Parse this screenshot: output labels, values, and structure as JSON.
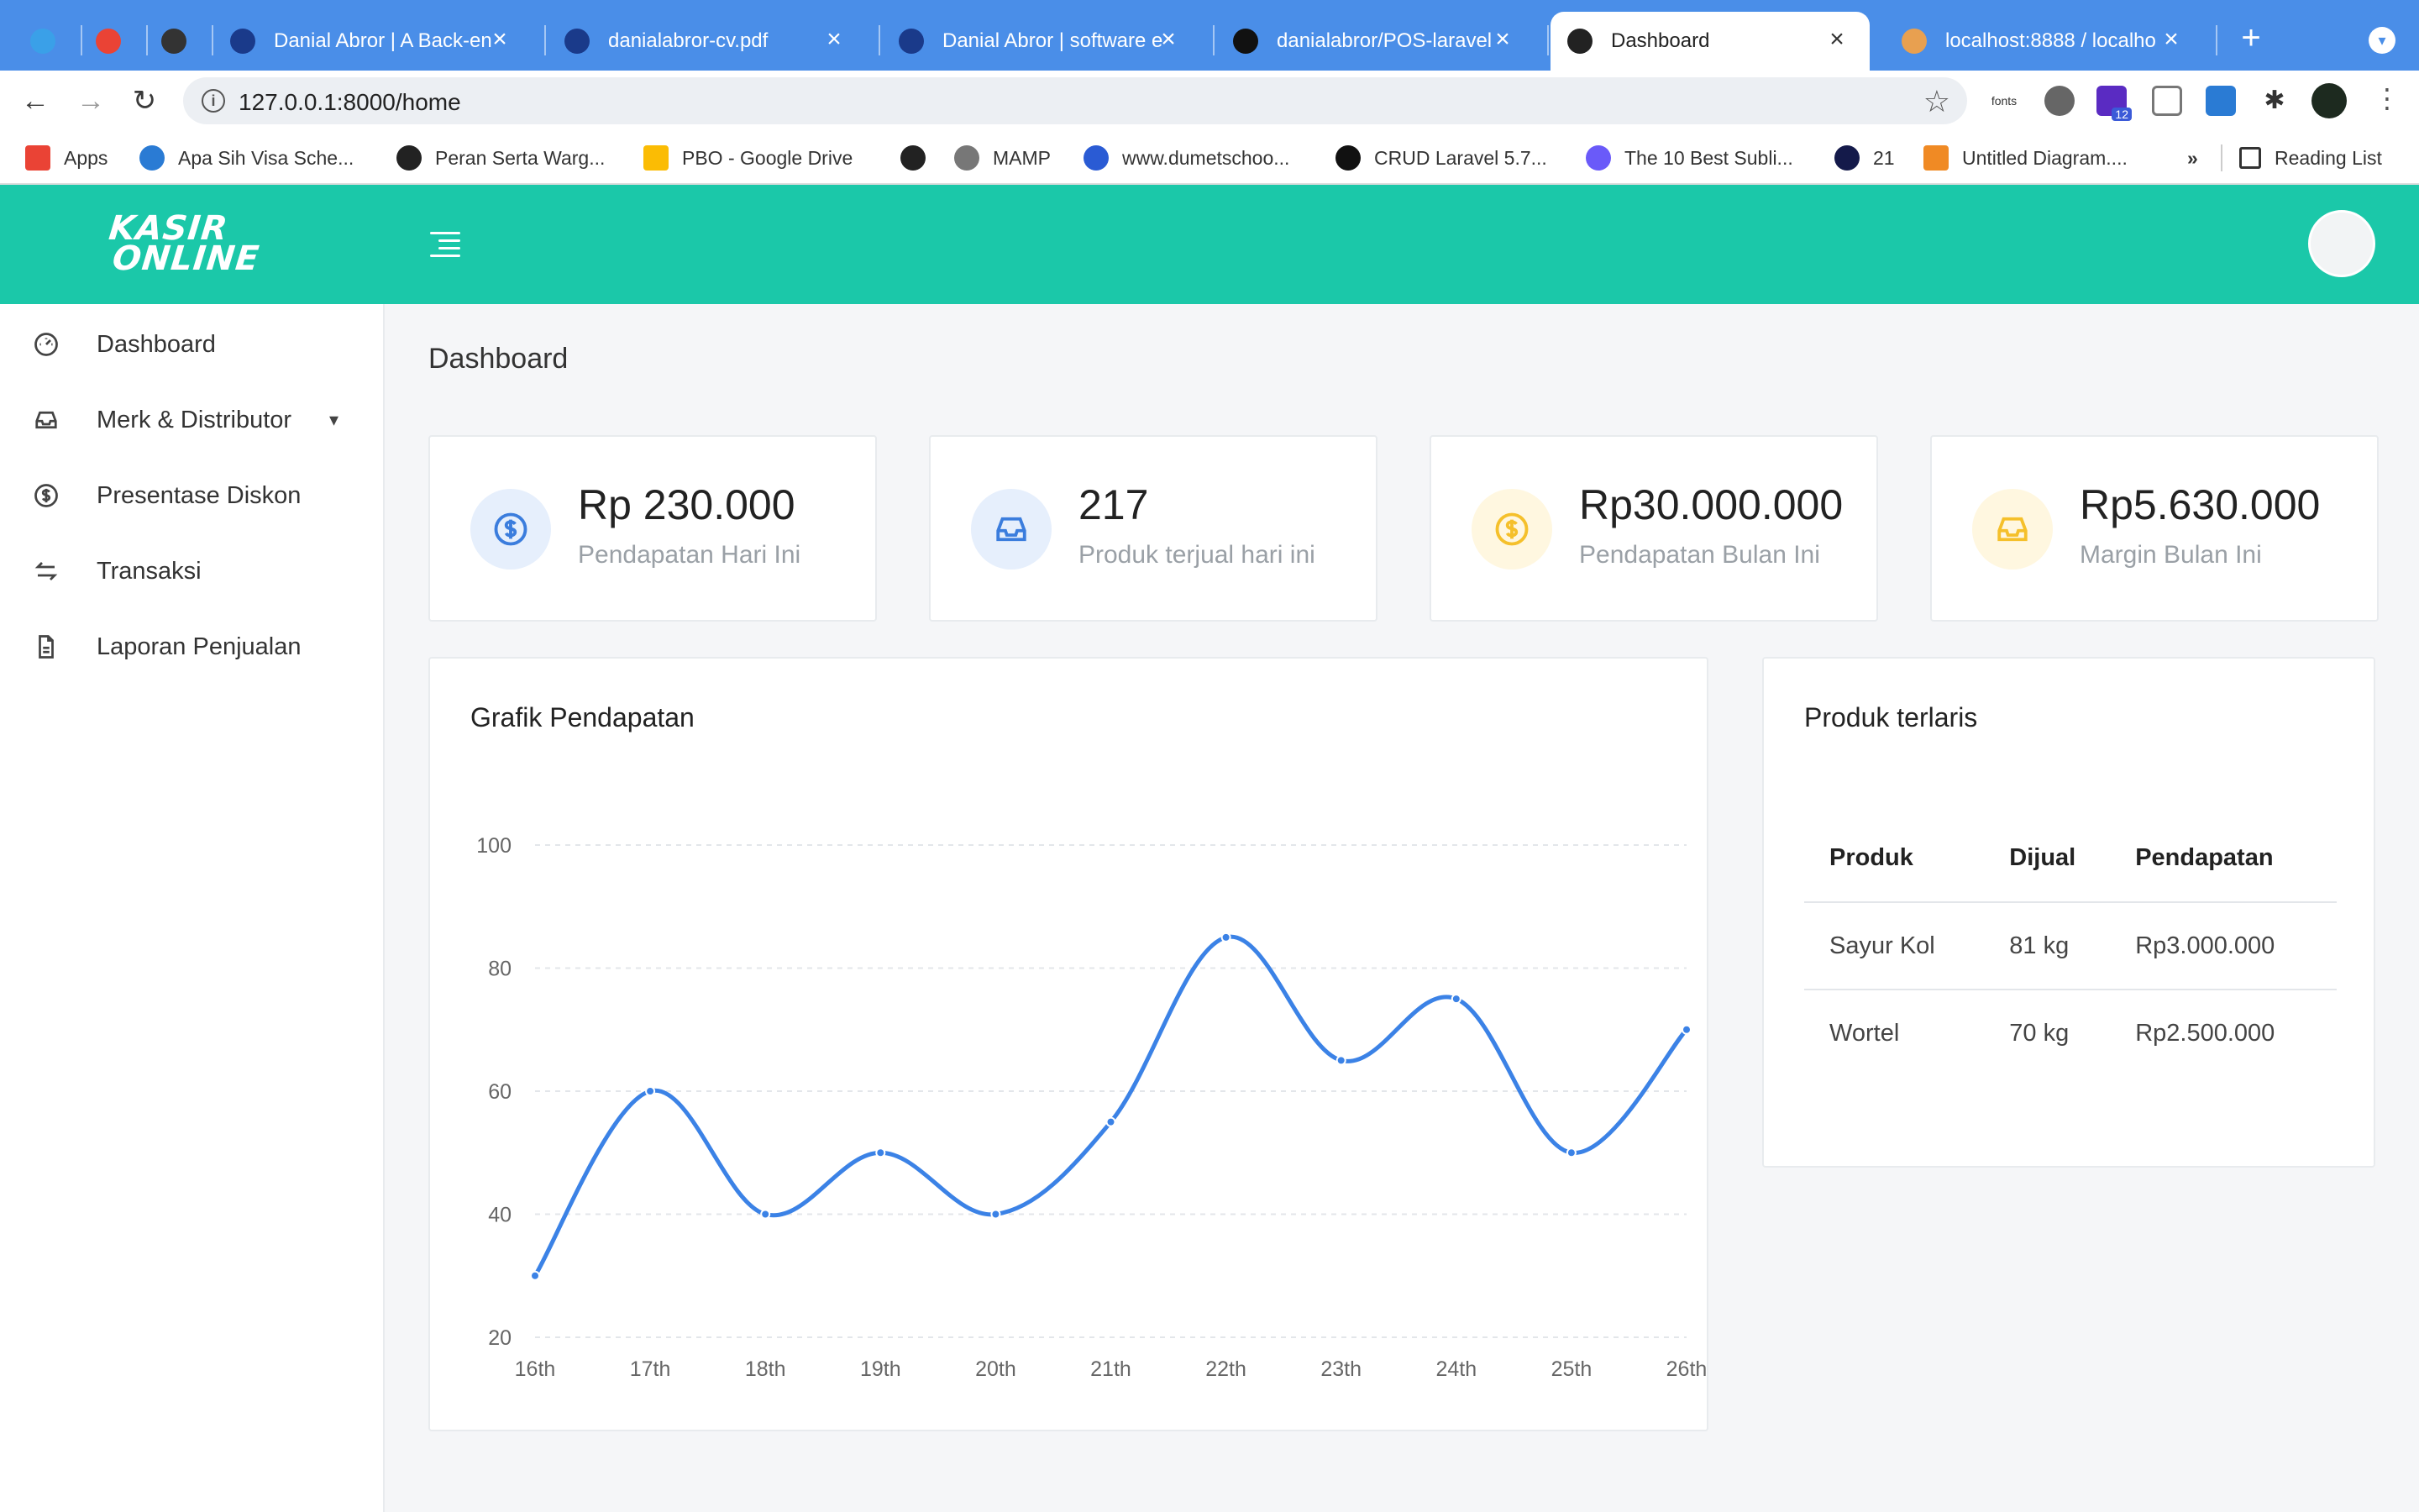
{
  "browser": {
    "tabs": [
      {
        "title": "",
        "favicon_color": "#3aa0e8",
        "icon": "telegram-icon"
      },
      {
        "title": "",
        "favicon_color": "#ea4335",
        "icon": "gmail-icon"
      },
      {
        "title": "",
        "favicon_color": "#333333",
        "icon": "star-app-icon"
      },
      {
        "title": "Danial Abror | A Back-en",
        "favicon_color": "#1a3a8a",
        "icon": "globe-icon"
      },
      {
        "title": "danialabror-cv.pdf",
        "favicon_color": "#1a3a8a",
        "icon": "globe-icon"
      },
      {
        "title": "Danial Abror | software e",
        "favicon_color": "#1a3a8a",
        "icon": "globe-icon"
      },
      {
        "title": "danialabror/POS-laravel",
        "favicon_color": "#111111",
        "icon": "github-icon"
      },
      {
        "title": "Dashboard",
        "favicon_color": "#222222",
        "icon": "ko-icon"
      },
      {
        "title": "localhost:8888 / localho",
        "favicon_color": "#e8a050",
        "icon": "phpmyadmin-icon"
      }
    ],
    "url": "127.0.0.1:8000/home",
    "bookmarks": [
      {
        "label": "Apps",
        "color": "#ea4335"
      },
      {
        "label": "Apa Sih Visa Sche...",
        "color": "#2a7bd4"
      },
      {
        "label": "Peran Serta Warg...",
        "color": "#222222"
      },
      {
        "label": "PBO - Google Drive",
        "color": "#fbbc04"
      },
      {
        "label": "",
        "color": "#222222"
      },
      {
        "label": "MAMP",
        "color": "#777777"
      },
      {
        "label": "www.dumetschoo...",
        "color": "#2a5bd4"
      },
      {
        "label": "CRUD Laravel 5.7...",
        "color": "#111111"
      },
      {
        "label": "The 10 Best Subli...",
        "color": "#6a5af9"
      },
      {
        "label": "21",
        "color": "#141a4a"
      },
      {
        "label": "Untitled Diagram....",
        "color": "#f08a24"
      }
    ],
    "more_bookmarks": "»",
    "reading_list": "Reading List",
    "extension_fonts": "fonts",
    "extension_badge": "12",
    "new_tab": "+"
  },
  "app": {
    "logo_line1": "KASIR",
    "logo_line2": "ONLINE",
    "accent": "#1bc8a9",
    "sidebar": [
      {
        "label": "Dashboard",
        "icon": "gauge-icon"
      },
      {
        "label": "Merk & Distributor",
        "icon": "inbox-icon",
        "has_submenu": true
      },
      {
        "label": "Presentase Diskon",
        "icon": "dollar-circle-icon"
      },
      {
        "label": "Transaksi",
        "icon": "swap-arrows-icon"
      },
      {
        "label": "Laporan Penjualan",
        "icon": "file-icon"
      }
    ],
    "page_title": "Dashboard",
    "stats": [
      {
        "value": "Rp 230.000",
        "label": "Pendapatan Hari Ini",
        "icon": "dollar-circle-icon",
        "color": "#3b7ddd",
        "bg": "#e6effc"
      },
      {
        "value": "217",
        "label": "Produk terjual hari ini",
        "icon": "inbox-icon",
        "color": "#3b7ddd",
        "bg": "#e6effc"
      },
      {
        "value": "Rp30.000.000",
        "label": "Pendapatan Bulan Ini",
        "icon": "dollar-circle-icon",
        "color": "#f5c02b",
        "bg": "#fff7e0"
      },
      {
        "value": "Rp5.630.000",
        "label": "Margin Bulan Ini",
        "icon": "inbox-icon",
        "color": "#f5c02b",
        "bg": "#fff7e0"
      }
    ],
    "chart_title": "Grafik Pendapatan",
    "top_products": {
      "title": "Produk terlaris",
      "columns": [
        "Produk",
        "Dijual",
        "Pendapatan"
      ],
      "rows": [
        [
          "Sayur Kol",
          "81 kg",
          "Rp3.000.000"
        ],
        [
          "Wortel",
          "70 kg",
          "Rp2.500.000"
        ]
      ]
    }
  },
  "chart_data": {
    "type": "line",
    "title": "Grafik Pendapatan",
    "categories": [
      "16th",
      "17th",
      "18th",
      "19th",
      "20th",
      "21th",
      "22th",
      "23th",
      "24th",
      "25th",
      "26th"
    ],
    "series": [
      {
        "values": [
          30,
          60,
          40,
          50,
          40,
          55,
          85,
          65,
          75,
          50,
          70
        ]
      }
    ],
    "y_ticks": [
      20,
      40,
      60,
      80,
      100
    ],
    "ylim": [
      20,
      100
    ],
    "grid": true,
    "line_color": "#3b82e6"
  }
}
